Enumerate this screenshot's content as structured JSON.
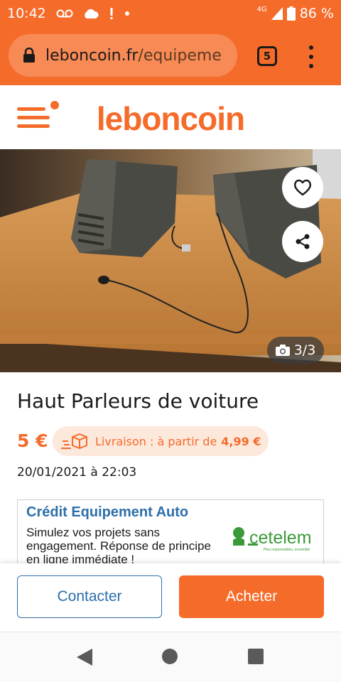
{
  "status_bar": {
    "time": "10:42",
    "icons_left": [
      "voicemail-icon",
      "cloud-icon",
      "alert-icon",
      "dot-icon"
    ],
    "network": "4G",
    "battery": "86 %"
  },
  "browser": {
    "url_domain": "leboncoin.fr",
    "url_path": "/equipeme",
    "tab_count": "5"
  },
  "site": {
    "logo": "leboncoin"
  },
  "listing": {
    "photo_counter": "3/3",
    "title": "Haut Parleurs de voiture",
    "price": "5 €",
    "delivery_label": "Livraison : à partir de",
    "delivery_price": "4,99 €",
    "date": "20/01/2021 à 22:03"
  },
  "ad": {
    "title": "Crédit Equipement Auto",
    "text": "Simulez vos projets sans engagement. Réponse de principe en ligne immédiate !",
    "brand": "cetelem",
    "brand_tagline": "Plus responsables, ensemble"
  },
  "actions": {
    "contact_label": "Contacter",
    "buy_label": "Acheter"
  },
  "colors": {
    "brand_orange": "#f56b2a",
    "link_blue": "#2c6fa9",
    "cetelem_green": "#3a9a3a"
  }
}
